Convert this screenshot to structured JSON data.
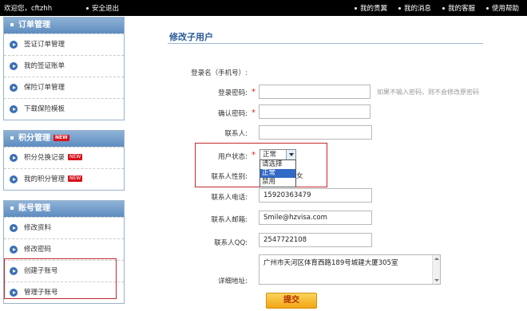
{
  "topbar": {
    "welcome": "欢迎您，cftzhh",
    "logout": "安全退出",
    "links": [
      "我的贵翼",
      "我的消息",
      "我的客服",
      "使用帮助"
    ]
  },
  "sidebar": {
    "order": {
      "title": "订单管理",
      "items": [
        {
          "label": "签证订单管理"
        },
        {
          "label": "我的签证账单"
        },
        {
          "label": "保险订单管理"
        },
        {
          "label": "下载保险模板"
        }
      ]
    },
    "points": {
      "title": "积分管理",
      "badge": "NEW",
      "items": [
        {
          "label": "积分兑换记录",
          "badge": "NEW"
        },
        {
          "label": "我的积分管理",
          "badge": "NEW"
        }
      ]
    },
    "account": {
      "title": "账号管理",
      "items": [
        {
          "label": "修改资料"
        },
        {
          "label": "修改密码"
        },
        {
          "label": "创建子账号"
        },
        {
          "label": "管理子账号"
        }
      ]
    }
  },
  "form": {
    "title": "修改子用户",
    "login_name_label": "登录名（手机号）:",
    "password_label": "登录密码:",
    "password_hint": "如果不输入密码，则不会修改原密码",
    "confirm_label": "确认密码:",
    "contact_label": "联系人:",
    "status_label": "用户状态:",
    "status_value": "正常",
    "status_options": [
      "请选择",
      "正常",
      "禁用"
    ],
    "gender_label": "联系人性别:",
    "gender_female": "女",
    "phone_label": "联系人电话:",
    "phone_value": "15920363479",
    "email_label": "联系人邮箱:",
    "email_value": "Smile@hzvisa.com",
    "qq_label": "联系人QQ:",
    "qq_value": "2547722108",
    "address_label": "详细地址:",
    "address_value": "广州市天河区体育西路189号城建大厦305室",
    "submit_label": "提交"
  },
  "colors": {
    "accent": "#2a5a9a",
    "highlight_box": "#c0282d",
    "submit_bg": "#f1a516"
  }
}
